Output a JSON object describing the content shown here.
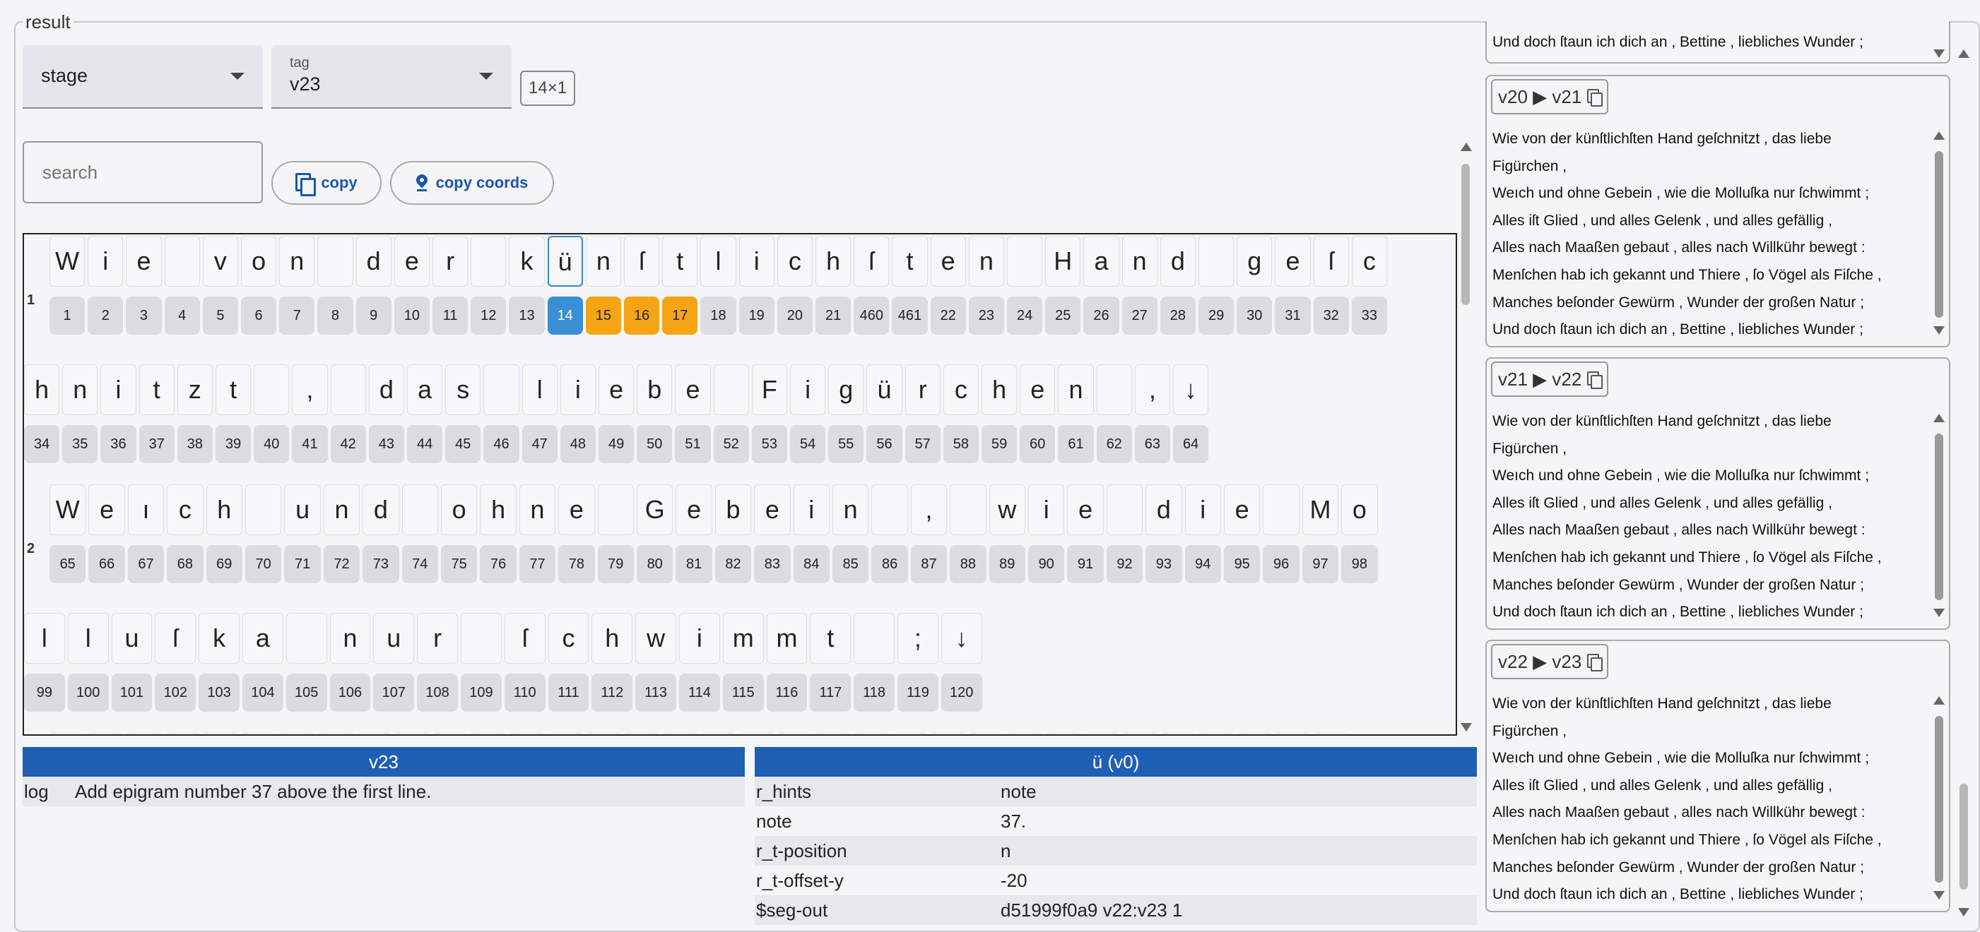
{
  "result_label": "result",
  "stage_select": {
    "label": "stage",
    "value": ""
  },
  "tag_select": {
    "label": "tag",
    "value": "v23"
  },
  "dims": "14×1",
  "search": {
    "placeholder": "search"
  },
  "buttons": {
    "copy": "copy",
    "copy_coords": "copy coords"
  },
  "viewer": {
    "lines": [
      {
        "number": "1",
        "rows": [
          {
            "chars": [
              "W",
              "i",
              "e",
              "",
              "v",
              "o",
              "n",
              "",
              "d",
              "e",
              "r",
              "",
              "k",
              "ü",
              "n",
              "ſ",
              "t",
              "l",
              "i",
              "c",
              "h",
              "ſ",
              "t",
              "e",
              "n",
              "",
              "H",
              "a",
              "n",
              "d",
              "",
              "g",
              "e",
              "ſ",
              "c"
            ],
            "nums": [
              "1",
              "2",
              "3",
              "4",
              "5",
              "6",
              "7",
              "8",
              "9",
              "10",
              "11",
              "12",
              "13",
              "14",
              "15",
              "16",
              "17",
              "18",
              "19",
              "20",
              "21",
              "460",
              "461",
              "22",
              "23",
              "24",
              "25",
              "26",
              "27",
              "28",
              "29",
              "30",
              "31",
              "32",
              "33"
            ]
          },
          {
            "chars": [
              "h",
              "n",
              "i",
              "t",
              "z",
              "t",
              "",
              ",",
              "",
              "d",
              "a",
              "s",
              "",
              "l",
              "i",
              "e",
              "b",
              "e",
              "",
              "F",
              "i",
              "g",
              "ü",
              "r",
              "c",
              "h",
              "e",
              "n",
              "",
              ",",
              "↓"
            ],
            "nums": [
              "34",
              "35",
              "36",
              "37",
              "38",
              "39",
              "40",
              "41",
              "42",
              "43",
              "44",
              "45",
              "46",
              "47",
              "48",
              "49",
              "50",
              "51",
              "52",
              "53",
              "54",
              "55",
              "56",
              "57",
              "58",
              "59",
              "60",
              "61",
              "62",
              "63",
              "64"
            ]
          }
        ]
      },
      {
        "number": "2",
        "rows": [
          {
            "chars": [
              "W",
              "e",
              "ı",
              "c",
              "h",
              "",
              "u",
              "n",
              "d",
              "",
              "o",
              "h",
              "n",
              "e",
              "",
              "G",
              "e",
              "b",
              "e",
              "i",
              "n",
              "",
              ",",
              "",
              "w",
              "i",
              "e",
              "",
              "d",
              "i",
              "e",
              "",
              "M",
              "o"
            ],
            "nums": [
              "65",
              "66",
              "67",
              "68",
              "69",
              "70",
              "71",
              "72",
              "73",
              "74",
              "75",
              "76",
              "77",
              "78",
              "79",
              "80",
              "81",
              "82",
              "83",
              "84",
              "85",
              "86",
              "87",
              "88",
              "89",
              "90",
              "91",
              "92",
              "93",
              "94",
              "95",
              "96",
              "97",
              "98"
            ]
          },
          {
            "chars": [
              "l",
              "l",
              "u",
              "ſ",
              "k",
              "a",
              "",
              "n",
              "u",
              "r",
              "",
              "ſ",
              "c",
              "h",
              "w",
              "i",
              "m",
              "m",
              "t",
              "",
              ";",
              "↓"
            ],
            "nums": [
              "99",
              "100",
              "101",
              "102",
              "103",
              "104",
              "105",
              "106",
              "107",
              "108",
              "109",
              "110",
              "111",
              "112",
              "113",
              "114",
              "115",
              "116",
              "117",
              "118",
              "119",
              "120"
            ]
          }
        ]
      }
    ]
  },
  "left_table": {
    "header": "v23",
    "rows": [
      {
        "key": "log",
        "value": "Add epigram number 37 above the first line."
      }
    ]
  },
  "right_table": {
    "header": "ü (v0)",
    "rows": [
      {
        "key": "r_hints",
        "value": "note"
      },
      {
        "key": "note",
        "value": "37."
      },
      {
        "key": "r_t-position",
        "value": "n"
      },
      {
        "key": "r_t-offset-y",
        "value": "-20"
      },
      {
        "key": "$seg-out",
        "value": "d51999f0a9 v22:v23 1"
      }
    ]
  },
  "panels": [
    {
      "title": "v20 ▶ v21"
    },
    {
      "title": "v21 ▶ v22"
    },
    {
      "title": "v22 ▶ v23"
    }
  ],
  "top_panel_partial": "Und doch ſtaun ich dich an , Bettine , liebliches Wunder ;",
  "poem_lines": [
    "Wie von der künſtlichſten Hand geſchnitzt , das liebe",
    "Figürchen ,",
    "Weıch und ohne Gebein , wie die Molluſka nur ſchwimmt ;",
    "Alles iſt Glied , und alles Gelenk , und alles gefällig ,",
    "Alles nach Maaßen gebaut , alles nach Willkühr bewegt :",
    "Menſchen hab ich gekannt und Thiere , ſo Vögel als Fiſche ,",
    "Manches beſonder Gewürm , Wunder der großen Natur ;",
    "Und doch ſtaun ich dich an , Bettine , liebliches Wunder ;"
  ]
}
